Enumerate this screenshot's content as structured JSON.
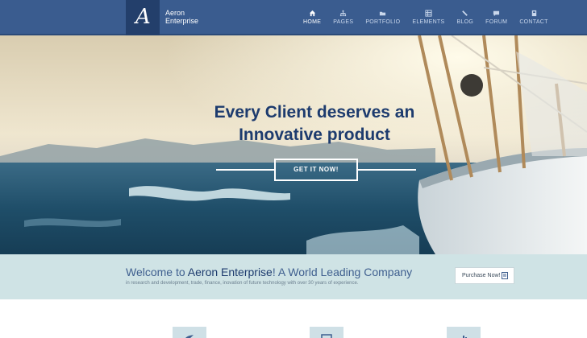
{
  "brand": {
    "line1": "Aeron",
    "line2": "Enterprise",
    "logo_letter": "A"
  },
  "nav": [
    {
      "label": "HOME",
      "icon": "home-icon",
      "active": true
    },
    {
      "label": "PAGES",
      "icon": "sitemap-icon",
      "active": false
    },
    {
      "label": "PORTFOLIO",
      "icon": "folder-icon",
      "active": false
    },
    {
      "label": "ELEMENTS",
      "icon": "grid-icon",
      "active": false
    },
    {
      "label": "BLOG",
      "icon": "pencil-icon",
      "active": false
    },
    {
      "label": "FORUM",
      "icon": "chat-icon",
      "active": false
    },
    {
      "label": "CONTACT",
      "icon": "contact-card-icon",
      "active": false
    }
  ],
  "hero": {
    "title_line1": "Every Client deserves an",
    "title_line2": "Innovative product",
    "cta": "GET IT NOW!"
  },
  "welcome": {
    "title_prefix": "Welcome to ",
    "title_highlight": "Aeron Enterprise",
    "title_suffix": "! A World Leading Company",
    "subtitle": "in research and development, trade, finance, inovation of future technology with over 30 years of experience.",
    "purchase_label": "Purchase Now!"
  },
  "features": [
    {
      "icon": "bird-icon"
    },
    {
      "icon": "monitor-icon"
    },
    {
      "icon": "chart-icon"
    }
  ],
  "colors": {
    "header": "#3a5c8f",
    "logo_bg": "#233f6b",
    "hero_title": "#1d3b6e",
    "welcome_band": "#cfe3e5"
  }
}
